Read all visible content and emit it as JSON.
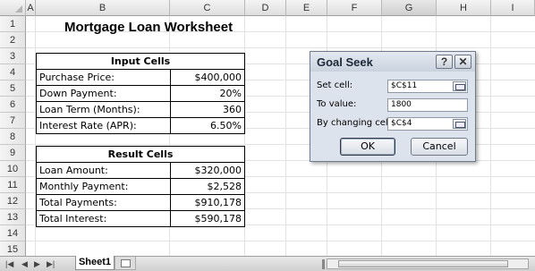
{
  "columns": [
    "A",
    "B",
    "C",
    "D",
    "E",
    "F",
    "G",
    "H",
    "I"
  ],
  "selected_column": "G",
  "rows": [
    "1",
    "2",
    "3",
    "4",
    "5",
    "6",
    "7",
    "8",
    "9",
    "10",
    "11",
    "12",
    "13",
    "14",
    "15"
  ],
  "worksheet": {
    "title": "Mortgage Loan Worksheet",
    "input_header": "Input Cells",
    "inputs": [
      {
        "label": "Purchase Price:",
        "value": "$400,000"
      },
      {
        "label": "Down Payment:",
        "value": "20%"
      },
      {
        "label": "Loan Term (Months):",
        "value": "360"
      },
      {
        "label": "Interest Rate (APR):",
        "value": "6.50%"
      }
    ],
    "result_header": "Result Cells",
    "results": [
      {
        "label": "Loan Amount:",
        "value": "$320,000"
      },
      {
        "label": "Monthly Payment:",
        "value": "$2,528"
      },
      {
        "label": "Total Payments:",
        "value": "$910,178"
      },
      {
        "label": "Total Interest:",
        "value": "$590,178"
      }
    ]
  },
  "goal_seek": {
    "title": "Goal Seek",
    "help_glyph": "?",
    "close_glyph": "✕",
    "set_cell_label": "Set cell:",
    "set_cell_value": "$C$11",
    "to_value_label": "To value:",
    "to_value_value": "1800",
    "changing_cell_label": "By changing cell:",
    "changing_cell_value": "$C$4",
    "ok_label": "OK",
    "cancel_label": "Cancel"
  },
  "tabbar": {
    "first_glyph": "|◀",
    "prev_glyph": "◀",
    "next_glyph": "▶",
    "last_glyph": "▶|",
    "sheet_tab": "Sheet1",
    "new_sheet_icon": "insert-worksheet-icon"
  }
}
